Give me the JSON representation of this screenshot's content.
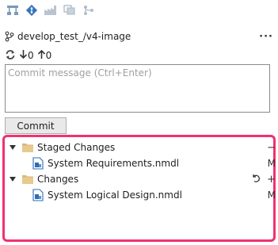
{
  "toolbar": {
    "buttons": [
      {
        "icon": "hierarchy-icon"
      },
      {
        "icon": "git-diamond-icon"
      },
      {
        "icon": "factory-icon"
      },
      {
        "icon": "copy-windows-icon"
      },
      {
        "icon": "branch-sync-icon"
      }
    ]
  },
  "branch": {
    "name": "develop_test_/v4-image",
    "more": "···"
  },
  "sync": {
    "incoming": "0",
    "outgoing": "0"
  },
  "commit": {
    "placeholder": "Commit message (Ctrl+Enter)",
    "value": "",
    "button_label": "Commit"
  },
  "changes": {
    "staged": {
      "label": "Staged Changes",
      "unstage_all": "−",
      "files": [
        {
          "name": "System Requirements.nmdl",
          "status": "M"
        }
      ]
    },
    "unstaged": {
      "label": "Changes",
      "discard_all": "⟲",
      "stage_all": "+",
      "files": [
        {
          "name": "System Logical Design.nmdl",
          "status": "M"
        }
      ]
    }
  },
  "colors": {
    "highlight_border": "#f0326f",
    "folder": "#dcb67a",
    "accent_blue": "#2e6db4"
  }
}
